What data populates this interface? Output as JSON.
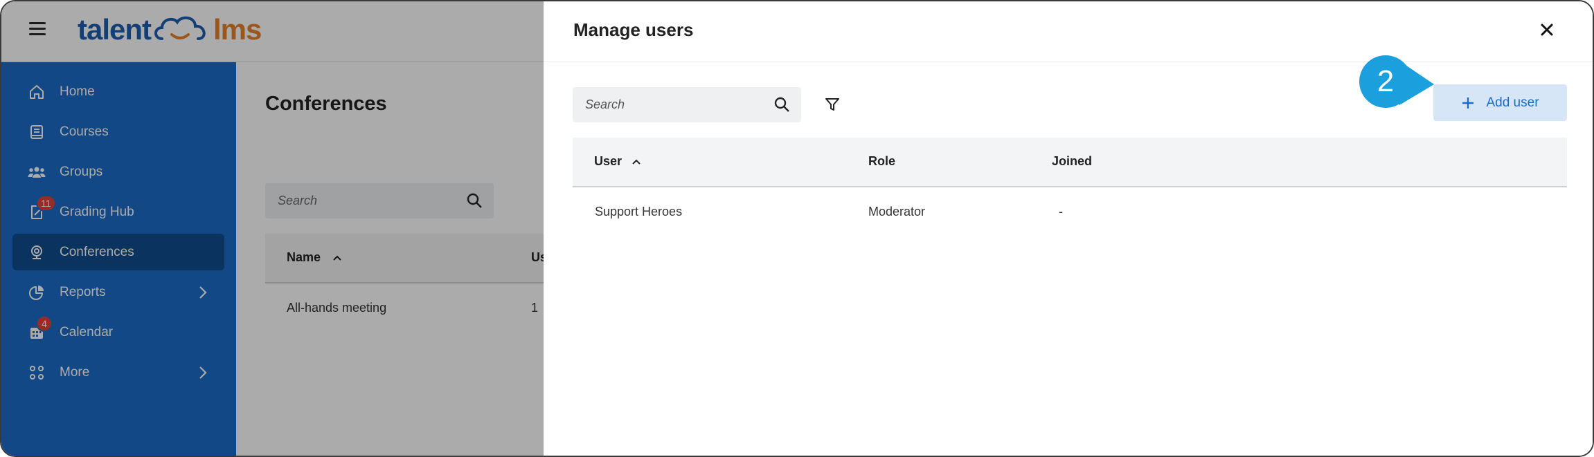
{
  "app": {
    "logo_left": "talent",
    "logo_right": "lms",
    "brand_blue": "#1c6cc7",
    "brand_orange": "#e8802a"
  },
  "sidebar": {
    "items": [
      {
        "label": "Home",
        "icon": "home-icon"
      },
      {
        "label": "Courses",
        "icon": "book-icon"
      },
      {
        "label": "Groups",
        "icon": "users-icon"
      },
      {
        "label": "Grading Hub",
        "icon": "grading-icon",
        "badge": "11"
      },
      {
        "label": "Conferences",
        "icon": "webcam-icon",
        "active": true
      },
      {
        "label": "Reports",
        "icon": "pie-chart-icon",
        "has_submenu": true
      },
      {
        "label": "Calendar",
        "icon": "calendar-icon",
        "badge": "4"
      },
      {
        "label": "More",
        "icon": "grid-icon",
        "has_submenu": true
      }
    ]
  },
  "background_page": {
    "title": "Conferences",
    "search_placeholder": "Search",
    "columns": [
      "Name",
      "Us"
    ],
    "rows": [
      [
        "All-hands meeting",
        "1"
      ]
    ]
  },
  "modal": {
    "title": "Manage users",
    "search_placeholder": "Search",
    "add_button_label": "Add user",
    "step_number": "2",
    "columns": {
      "user": "User",
      "role": "Role",
      "joined": "Joined"
    },
    "rows": [
      {
        "user": "Support Heroes",
        "role": "Moderator",
        "joined": "-"
      }
    ]
  }
}
